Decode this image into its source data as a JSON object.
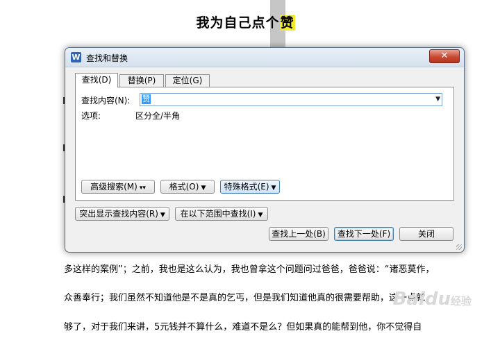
{
  "document": {
    "title_prefix": "我为自己点个",
    "title_highlight": "赞",
    "lines": [
      "多这样的案例”；之前，我也是这么认为，我也曾拿这个问题问过爸爸，爸爸说：“诸恶莫作，",
      "众善奉行；我们虽然不知道他是不是真的乞丐，但是我们知道他真的很需要帮助，这一点就",
      "够了，对于我们来讲，5元钱并不算什么，难道不是么？但如果真的能帮到他，你不觉得自"
    ],
    "watermark": "Baidu",
    "watermark_suffix": "经验"
  },
  "dialog": {
    "app_icon": "W",
    "title": "查找和替换",
    "close_glyph": "✕",
    "tabs": [
      {
        "label": "查找(D)"
      },
      {
        "label": "替换(P)"
      },
      {
        "label": "定位(G)"
      }
    ],
    "find_label": "查找内容(N):",
    "find_value": "赞",
    "options_label": "选项:",
    "options_value": "区分全/半角",
    "buttons": {
      "advanced_search": "高级搜索(M)",
      "format": "格式(O)",
      "special_format": "特殊格式(E)",
      "highlight_found": "突出显示查找内容(R)",
      "find_in_range": "在以下范围中查找(I)",
      "find_previous": "查找上一处(B)",
      "find_next": "查找下一处(F)",
      "close": "关闭"
    },
    "icons": {
      "dropdown": "chevron-down-icon",
      "double_caret": "double-chevron-down-icon"
    }
  }
}
